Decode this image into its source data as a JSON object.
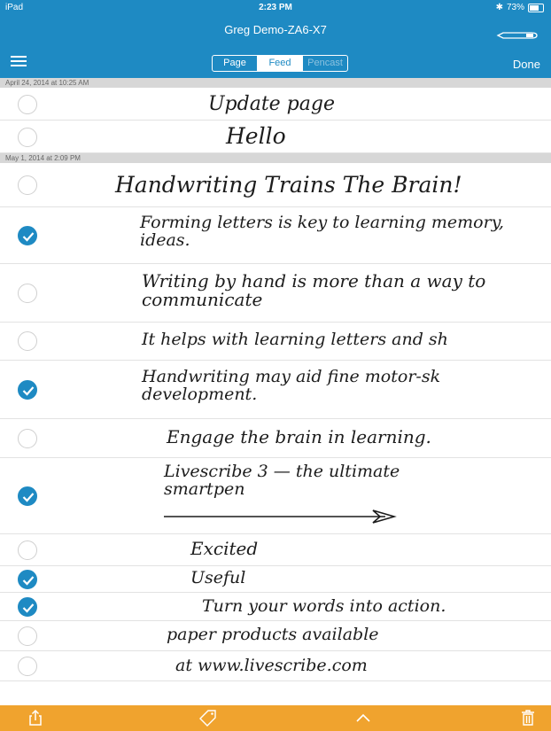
{
  "status": {
    "device": "iPad",
    "time": "2:23 PM",
    "battery": "73%"
  },
  "header": {
    "title": "Greg Demo-ZA6-X7",
    "tabs": [
      {
        "label": "Page",
        "state": "normal"
      },
      {
        "label": "Feed",
        "state": "active"
      },
      {
        "label": "Pencast",
        "state": "disabled"
      }
    ],
    "done_label": "Done"
  },
  "colors": {
    "header": "#1e8ac3",
    "toolbar": "#f0a32e",
    "check": "#1e8ac3"
  },
  "feed": {
    "groups": [
      {
        "date": "April 24, 2014 at 10:25 AM",
        "entries": [
          {
            "text": "Update page",
            "checked": false
          },
          {
            "text": "Hello",
            "checked": false
          }
        ]
      },
      {
        "date": "May 1, 2014 at 2:09 PM",
        "entries": [
          {
            "text": "Handwriting Trains The Brain!",
            "checked": false
          },
          {
            "text": "Forming letters is key to learning memory, ideas.",
            "checked": true
          },
          {
            "text": "Writing by hand is more than a way to communicate",
            "checked": false
          },
          {
            "text": "It helps with learning letters and sh",
            "checked": false
          },
          {
            "text": "Handwriting may aid fine motor-sk development.",
            "checked": true
          },
          {
            "text": "Engage the brain in learning.",
            "checked": false
          },
          {
            "text": "Livescribe 3 — the ultimate smartpen",
            "checked": true
          },
          {
            "text": "Excited",
            "checked": false
          },
          {
            "text": "Useful",
            "checked": true
          },
          {
            "text": "Turn your words into action.",
            "checked": true
          },
          {
            "text": "paper products available",
            "checked": false
          },
          {
            "text": "at www.livescribe.com",
            "checked": false
          }
        ]
      }
    ]
  },
  "toolbar": {
    "icons": [
      "share-icon",
      "tag-icon",
      "chevron-up-icon",
      "trash-icon"
    ]
  }
}
